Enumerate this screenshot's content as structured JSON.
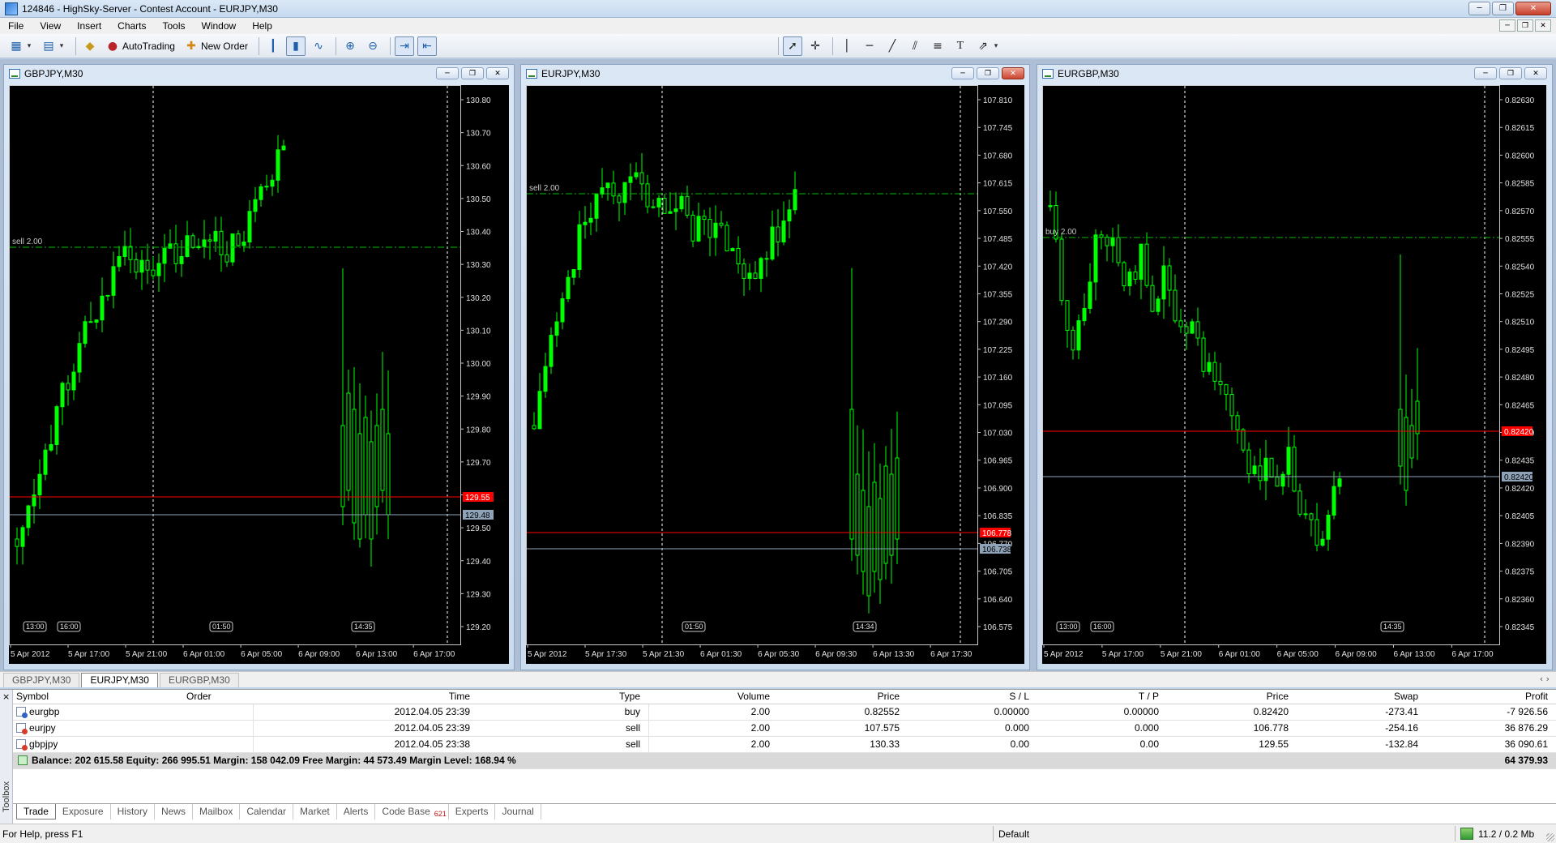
{
  "window": {
    "title": "124846 - HighSky-Server - Contest Account - EURJPY,M30",
    "minimize": "─",
    "restore": "❐",
    "close": "✕"
  },
  "menu": [
    "File",
    "View",
    "Insert",
    "Charts",
    "Tools",
    "Window",
    "Help"
  ],
  "toolbar": {
    "autotrading_label": "AutoTrading",
    "new_order_label": "New Order"
  },
  "charts": [
    {
      "title": "GBPJPY,M30",
      "bid_line": "129.55",
      "ask_line": "129.48",
      "trade_label": "sell 2.00",
      "price_ticks": [
        "130.80",
        "130.70",
        "130.60",
        "130.50",
        "130.40",
        "130.30",
        "130.20",
        "130.10",
        "130.00",
        "129.90",
        "129.80",
        "129.70",
        "129.60",
        "129.50",
        "129.40",
        "129.30",
        "129.20"
      ],
      "time_ticks": [
        "5 Apr 2012",
        "5 Apr 17:00",
        "5 Apr 21:00",
        "6 Apr 01:00",
        "6 Apr 05:00",
        "6 Apr 09:00",
        "6 Apr 13:00",
        "6 Apr 17:00"
      ],
      "session_labels": [
        "13:00",
        "16:00",
        "01:50",
        "14:35"
      ]
    },
    {
      "title": "EURJPY,M30",
      "bid_line": "106.778",
      "ask_line": "106.738",
      "trade_label": "sell 2.00",
      "price_ticks": [
        "107.810",
        "107.745",
        "107.680",
        "107.615",
        "107.550",
        "107.485",
        "107.420",
        "107.355",
        "107.290",
        "107.225",
        "107.160",
        "107.095",
        "107.030",
        "106.965",
        "106.900",
        "106.835",
        "106.770",
        "106.705",
        "106.640",
        "106.575"
      ],
      "time_ticks": [
        "5 Apr 2012",
        "5 Apr 17:30",
        "5 Apr 21:30",
        "6 Apr 01:30",
        "6 Apr 05:30",
        "6 Apr 09:30",
        "6 Apr 13:30",
        "6 Apr 17:30"
      ],
      "session_labels": [
        "01:50",
        "14:34"
      ]
    },
    {
      "title": "EURGBP,M30",
      "bid_line": "0.82420",
      "ask_line": "0.82420",
      "trade_label": "buy 2.00",
      "price_ticks": [
        "0.82630",
        "0.82615",
        "0.82600",
        "0.82585",
        "0.82570",
        "0.82555",
        "0.82540",
        "0.82525",
        "0.82510",
        "0.82495",
        "0.82480",
        "0.82465",
        "0.82450",
        "0.82435",
        "0.82420",
        "0.82405",
        "0.82390",
        "0.82375",
        "0.82360",
        "0.82345"
      ],
      "time_ticks": [
        "5 Apr 2012",
        "5 Apr 17:00",
        "5 Apr 21:00",
        "6 Apr 01:00",
        "6 Apr 05:00",
        "6 Apr 09:00",
        "6 Apr 13:00",
        "6 Apr 17:00"
      ],
      "session_labels": [
        "13:00",
        "16:00",
        "14:35"
      ]
    }
  ],
  "chart_tabs": [
    "GBPJPY,M30",
    "EURJPY,M30",
    "EURGBP,M30"
  ],
  "chart_tab_arrows": "‹  ›",
  "terminal": {
    "close": "×",
    "toolbox_label": "Toolbox",
    "headers": {
      "symbol": "Symbol",
      "order": "Order",
      "time": "Time",
      "type": "Type",
      "volume": "Volume",
      "price": "Price",
      "sl": "S / L",
      "tp": "T / P",
      "cur_price": "Price",
      "swap": "Swap",
      "profit": "Profit"
    },
    "rows": [
      {
        "symbol": "eurgbp",
        "side": "buy",
        "time": "2012.04.05 23:39",
        "type": "buy",
        "volume": "2.00",
        "price": "0.82552",
        "sl": "0.00000",
        "tp": "0.00000",
        "cur_price": "0.82420",
        "swap": "-273.41",
        "profit": "-7 926.56"
      },
      {
        "symbol": "eurjpy",
        "side": "sell",
        "time": "2012.04.05 23:39",
        "type": "sell",
        "volume": "2.00",
        "price": "107.575",
        "sl": "0.000",
        "tp": "0.000",
        "cur_price": "106.778",
        "swap": "-254.16",
        "profit": "36 876.29"
      },
      {
        "symbol": "gbpjpy",
        "side": "sell",
        "time": "2012.04.05 23:38",
        "type": "sell",
        "volume": "2.00",
        "price": "130.33",
        "sl": "0.00",
        "tp": "0.00",
        "cur_price": "129.55",
        "swap": "-132.84",
        "profit": "36 090.61"
      }
    ],
    "balance_line": "Balance: 202 615.58  Equity: 266 995.51  Margin: 158 042.09  Free Margin: 44 573.49  Margin Level: 168.94 %",
    "total_profit": "64 379.93",
    "tabs": [
      "Trade",
      "Exposure",
      "History",
      "News",
      "Mailbox",
      "Calendar",
      "Market",
      "Alerts",
      "Code Base",
      "Experts",
      "Journal"
    ],
    "code_base_badge": "621"
  },
  "status": {
    "help": "For Help, press F1",
    "profile": "Default",
    "connection": "11.2 / 0.2 Mb"
  },
  "colors": {
    "candle_up": "#00ff00",
    "candle_down": "#000000",
    "wick": "#00ff00",
    "bid_line": "#ff0000",
    "ask_line": "#8fa3b8",
    "trade_line": "#00c000",
    "grid_vline": "#ffffff",
    "bid_badge": "#ff0000",
    "ask_badge": "#8fa3b8"
  }
}
